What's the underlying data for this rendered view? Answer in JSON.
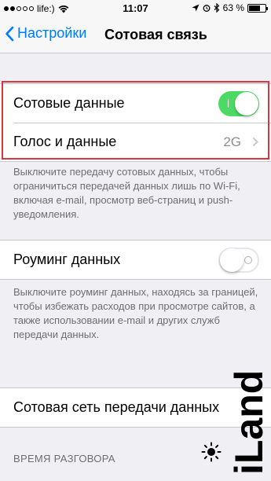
{
  "status_bar": {
    "carrier": "life:)",
    "time": "11:07",
    "battery_percent": "63 %",
    "signal_filled": 2,
    "signal_total": 5,
    "battery_level": 0.63
  },
  "nav": {
    "back_label": "Настройки",
    "title": "Сотовая связь"
  },
  "cellular_group": {
    "cellular_data_label": "Сотовые данные",
    "cellular_data_on": true,
    "voice_data_label": "Голос и данные",
    "voice_data_value": "2G"
  },
  "cellular_footer": "Выключите передачу сотовых данных, чтобы ограничиться передачей данных лишь по Wi-Fi, включая e-mail, просмотр веб-страниц и push-уведомления.",
  "roaming_group": {
    "roaming_label": "Роуминг данных",
    "roaming_on": false
  },
  "roaming_footer": "Выключите роуминг данных, находясь за границей, чтобы избежать расходов при просмотре сайтов, а также использовании e-mail и других служб передачи данных.",
  "network_group": {
    "network_label": "Сотовая сеть передачи данных"
  },
  "call_time_header": "ВРЕМЯ РАЗГОВОРА",
  "watermark_text": "iLand",
  "colors": {
    "accent": "#007aff",
    "toggle_on": "#4cd964",
    "highlight": "#d9363e"
  }
}
